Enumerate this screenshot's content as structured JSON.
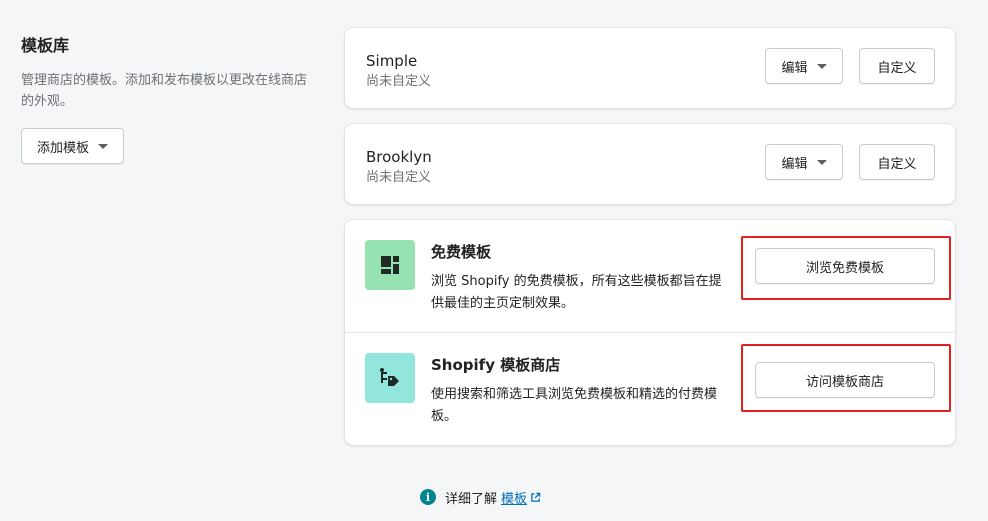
{
  "sidebar": {
    "title": "模板库",
    "description": "管理商店的模板。添加和发布模板以更改在线商店的外观。",
    "add_button": "添加模板"
  },
  "themes": [
    {
      "name": "Simple",
      "status": "尚未自定义",
      "edit_label": "编辑",
      "customize_label": "自定义"
    },
    {
      "name": "Brooklyn",
      "status": "尚未自定义",
      "edit_label": "编辑",
      "customize_label": "自定义"
    }
  ],
  "free_themes": {
    "title": "免费模板",
    "description": "浏览 Shopify 的免费模板，所有这些模板都旨在提供最佳的主页定制效果。",
    "button": "浏览免费模板",
    "icon": "layout-blocks-icon",
    "icon_bg": "#96e2b0"
  },
  "theme_store": {
    "title": "Shopify 模板商店",
    "description": "使用搜索和筛选工具浏览免费模板和精选的付费模板。",
    "button": "访问模板商店",
    "icon": "store-tag-icon",
    "icon_bg": "#92e6dc"
  },
  "footer": {
    "text": "详细了解",
    "link": "模板",
    "icon": "info-icon"
  },
  "colors": {
    "highlight": "#e0201f",
    "link": "#006fbb",
    "info": "#00848e"
  }
}
